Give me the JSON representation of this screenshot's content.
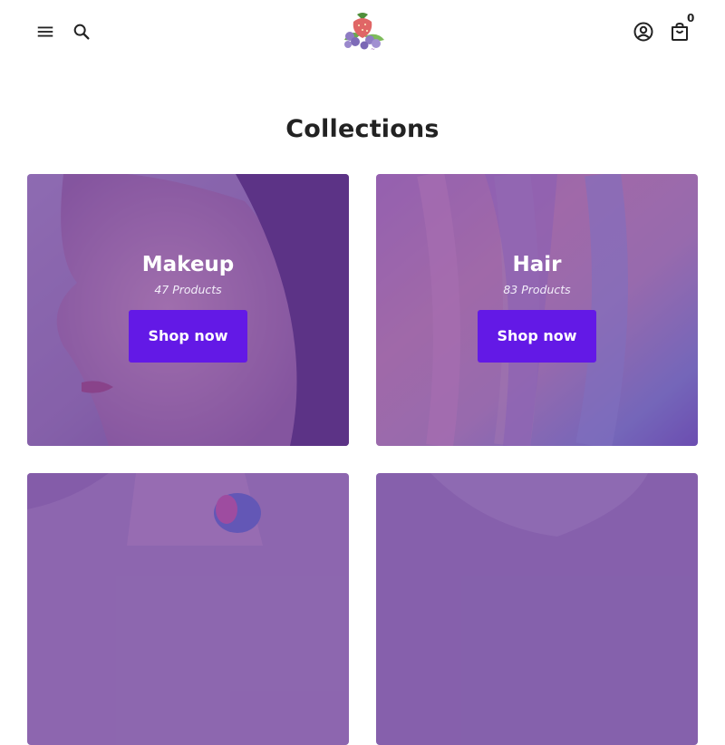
{
  "header": {
    "menu_icon": "hamburger-menu-icon",
    "search_icon": "search-icon",
    "account_icon": "account-icon",
    "cart_icon": "shopping-bag-icon",
    "cart_count": "0",
    "logo": "strawberry-grapes-logo"
  },
  "main": {
    "title": "Collections",
    "collections": [
      {
        "title": "Makeup",
        "count": "47 Products",
        "button": "Shop now"
      },
      {
        "title": "Hair",
        "count": "83 Products",
        "button": "Shop now"
      },
      {
        "title": "",
        "count": "",
        "button": ""
      },
      {
        "title": "",
        "count": "",
        "button": ""
      }
    ]
  },
  "colors": {
    "accent": "#6319e6",
    "overlay": "#5a2896",
    "text_dark": "#222222"
  }
}
